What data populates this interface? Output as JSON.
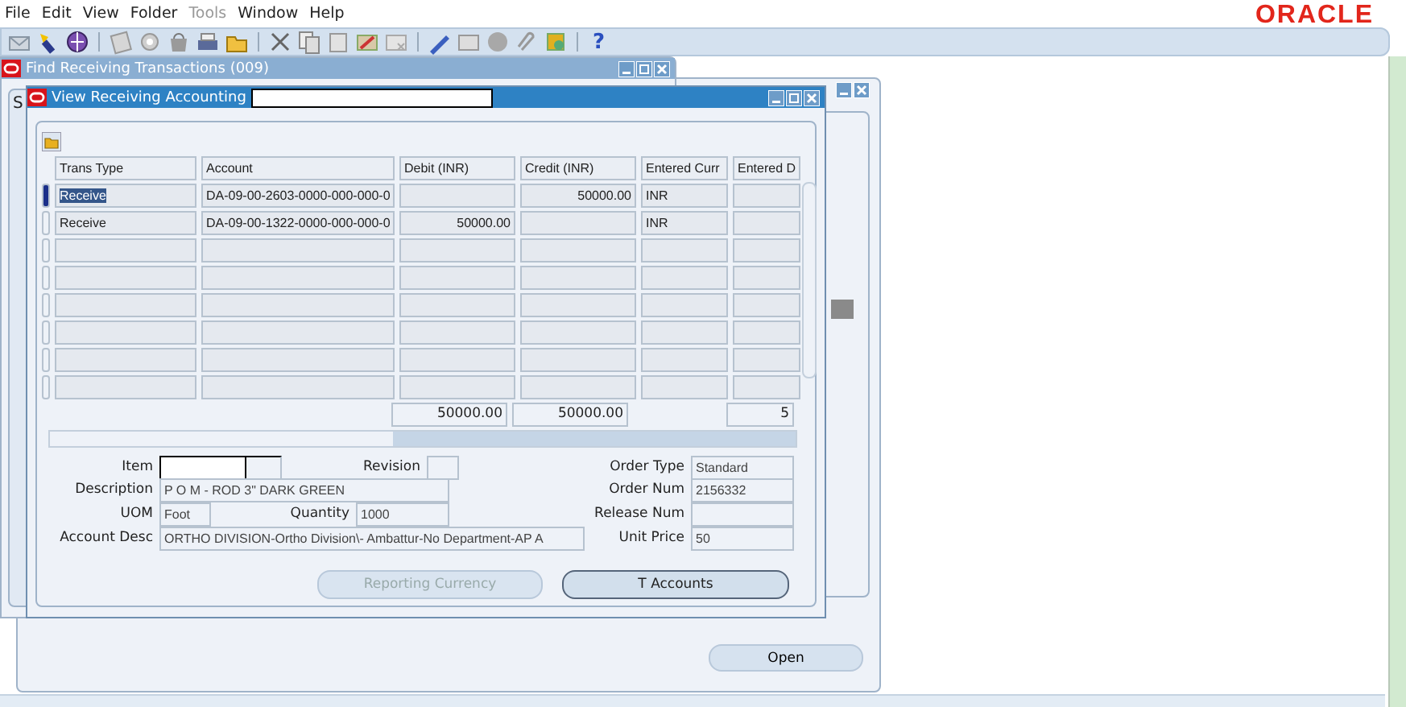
{
  "menu": [
    {
      "label": "File",
      "disabled": false
    },
    {
      "label": "Edit",
      "disabled": false
    },
    {
      "label": "View",
      "disabled": false
    },
    {
      "label": "Folder",
      "disabled": false
    },
    {
      "label": "Tools",
      "disabled": true
    },
    {
      "label": "Window",
      "disabled": false
    },
    {
      "label": "Help",
      "disabled": false
    }
  ],
  "logo": "ORACLE",
  "toolbar": {
    "help_glyph": "?"
  },
  "find_window": {
    "title": "Find Receiving Transactions (009)",
    "tab_label": "S"
  },
  "back_window": {
    "button": {
      "label": "Open"
    }
  },
  "accounting_window": {
    "title": "View Receiving Accounting",
    "title_redacted": true,
    "columns": [
      "Trans Type",
      "Account",
      "Debit (INR)",
      "Credit (INR)",
      "Entered Curr",
      "Entered D"
    ],
    "rows": [
      {
        "selected": true,
        "cells": [
          "Receive",
          "DA-09-00-2603-0000-000-000-0",
          "",
          "50000.00",
          "INR",
          ""
        ]
      },
      {
        "selected": false,
        "cells": [
          "Receive",
          "DA-09-00-1322-0000-000-000-0",
          "50000.00",
          "",
          "INR",
          ""
        ]
      },
      {
        "selected": false
      },
      {
        "selected": false
      },
      {
        "selected": false
      },
      {
        "selected": false
      },
      {
        "selected": false
      },
      {
        "selected": false
      }
    ],
    "totals": {
      "debit": "50000.00",
      "credit": "50000.00",
      "entered_d": "5"
    },
    "item": {
      "label": "Item",
      "redacted": true
    },
    "revision": {
      "label": "Revision"
    },
    "description": {
      "label": "Description",
      "value": "P O M - ROD 3\" DARK GREEN"
    },
    "uom": {
      "label": "UOM",
      "value": "Foot"
    },
    "quantity": {
      "label": "Quantity",
      "value": "1000"
    },
    "account_desc": {
      "label": "Account Desc",
      "value": "ORTHO DIVISION-Ortho Division\\- Ambattur-No Department-AP A"
    },
    "order_type": {
      "label": "Order Type",
      "value": "Standard"
    },
    "order_num": {
      "label": "Order Num",
      "value": "2156332"
    },
    "release_num": {
      "label": "Release Num"
    },
    "unit_price": {
      "label": "Unit Price",
      "value": "50"
    },
    "buttons": [
      {
        "label": "Reporting Currency",
        "disabled": true
      },
      {
        "label": "T Accounts",
        "disabled": false
      }
    ]
  }
}
